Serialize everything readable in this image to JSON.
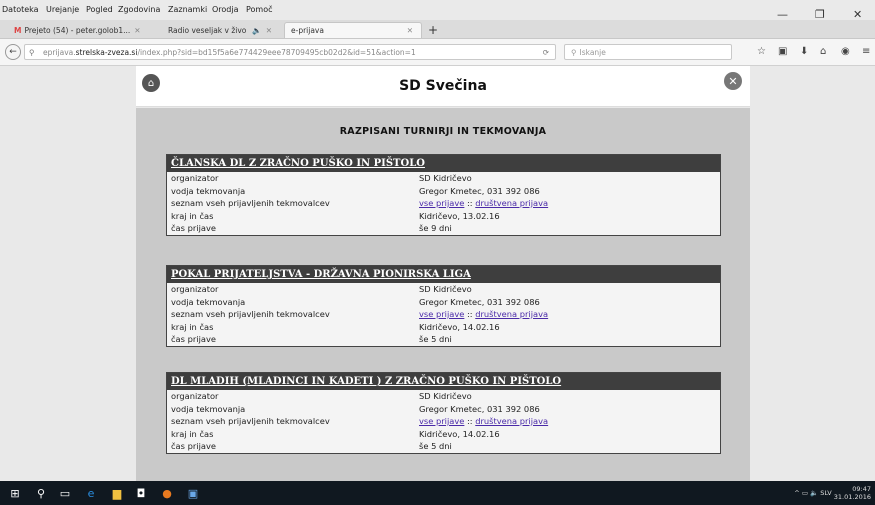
{
  "menubar": [
    "Datoteka",
    "Urejanje",
    "Pogled",
    "Zgodovina",
    "Zaznamki",
    "Orodja",
    "Pomoč"
  ],
  "tabs": [
    {
      "label": "Prejeto (54) - peter.golob1...",
      "icon": "gmail-icon"
    },
    {
      "label": "Radio veseljak v živo",
      "icon": "speaker-icon"
    },
    {
      "label": "e-prijava",
      "icon": "page-icon"
    }
  ],
  "address": {
    "prefix": "eprijava.",
    "host": "strelska-zveza.si",
    "path": "/index.php?sid=bd15f5a6e774429eee78709495cb02d2&id=51&action=1"
  },
  "search": {
    "placeholder": "Iskanje"
  },
  "page": {
    "club": "SD Svečina",
    "section_title": "RAZPISANI TURNIRJI IN TEKMOVANJA"
  },
  "labels": {
    "organizer": "organizator",
    "leader": "vodja tekmovanja",
    "list": "seznam vseh prijavljenih tekmovalcev",
    "place": "kraj in čas",
    "time_left": "čas prijave",
    "all_entries": "vse prijave",
    "separator": "::",
    "club_entry": "društvena prijava"
  },
  "competitions": [
    {
      "title": "ČLANSKA DL Z ZRAČNO PUŠKO IN PIŠTOLO",
      "organizer": "SD Kidričevo",
      "leader": "Gregor Kmetec, 031 392 086",
      "place": "Kidričevo, 13.02.16",
      "time_left": "še 9 dni"
    },
    {
      "title": "POKAL PRIJATELJSTVA - DRŽAVNA PIONIRSKA LIGA",
      "organizer": "SD Kidričevo",
      "leader": "Gregor Kmetec, 031 392 086",
      "place": "Kidričevo, 14.02.16",
      "time_left": "še 5 dni"
    },
    {
      "title": "DL MLADIH (MLADINCI IN KADETI ) Z ZRAČNO PUŠKO IN PIŠTOLO",
      "organizer": "SD Kidričevo",
      "leader": "Gregor Kmetec, 031 392 086",
      "place": "Kidričevo, 14.02.16",
      "time_left": "še 5 dni"
    }
  ],
  "tray": {
    "lang": "SLV",
    "time": "09:47",
    "date": "31.01.2016"
  }
}
